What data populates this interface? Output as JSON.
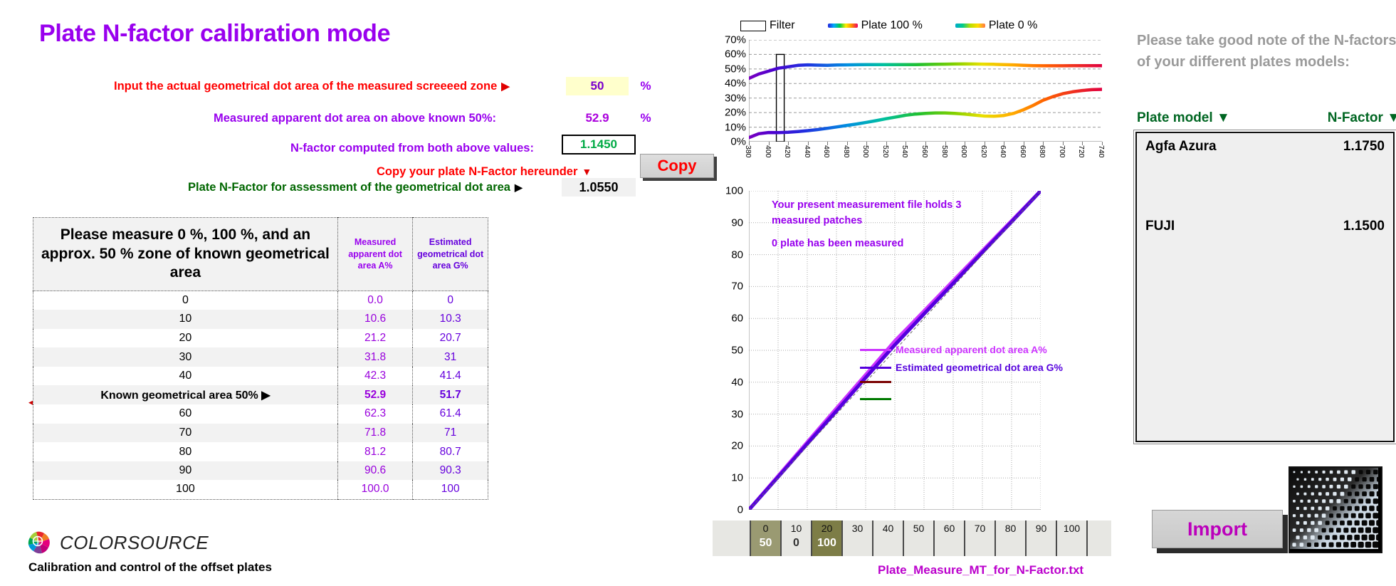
{
  "title": "Plate N-factor calibration mode",
  "form": {
    "input_label": "Input the actual geometrical dot area of the measured screeeed zone",
    "input_value": "50",
    "input_unit": "%",
    "measured_label": "Measured apparent dot area on above known 50%:",
    "measured_value": "52.9",
    "measured_unit": "%",
    "nfactor_label": "N-factor computed from both above values:",
    "nfactor_value": "1.1450",
    "copy_label": "Copy your plate N-Factor hereunder",
    "copy_button": "Copy",
    "plate_nfactor_label": "Plate N-Factor for assessment of the geometrical dot area",
    "plate_nfactor_value": "1.0550"
  },
  "table": {
    "header_main": "Please measure 0 %, 100 %, and an approx. 50 % zone of known geometrical area",
    "header_a": "Measured apparent dot area A%",
    "header_g": "Estimated geometrical dot area G%",
    "rows": [
      {
        "label": "0",
        "a": "0.0",
        "g": "0",
        "known": false
      },
      {
        "label": "10",
        "a": "10.6",
        "g": "10.3",
        "known": false
      },
      {
        "label": "20",
        "a": "21.2",
        "g": "20.7",
        "known": false
      },
      {
        "label": "30",
        "a": "31.8",
        "g": "31",
        "known": false
      },
      {
        "label": "40",
        "a": "42.3",
        "g": "41.4",
        "known": false
      },
      {
        "label": "Known geometrical area 50%",
        "a": "52.9",
        "g": "51.7",
        "known": true
      },
      {
        "label": "60",
        "a": "62.3",
        "g": "61.4",
        "known": false
      },
      {
        "label": "70",
        "a": "71.8",
        "g": "71",
        "known": false
      },
      {
        "label": "80",
        "a": "81.2",
        "g": "80.7",
        "known": false
      },
      {
        "label": "90",
        "a": "90.6",
        "g": "90.3",
        "known": false
      },
      {
        "label": "100",
        "a": "100.0",
        "g": "100",
        "known": false
      }
    ]
  },
  "brand": {
    "name": "COLORSOURCE",
    "subtitle": "Calibration and control of the offset plates",
    "logo_icon": "color-wheel-icon"
  },
  "chart_data": [
    {
      "type": "line",
      "name": "spectral-reflectance-chart",
      "title": "",
      "xlabel": "",
      "ylabel": "",
      "xlim": [
        380,
        740
      ],
      "ylim": [
        0,
        70
      ],
      "ytick_labels": [
        "0%",
        "10%",
        "20%",
        "30%",
        "40%",
        "50%",
        "60%",
        "70%"
      ],
      "ytick_values": [
        0,
        10,
        20,
        30,
        40,
        50,
        60,
        70
      ],
      "xticks": [
        380,
        400,
        420,
        440,
        460,
        480,
        500,
        520,
        540,
        560,
        580,
        600,
        620,
        640,
        660,
        680,
        700,
        720,
        740
      ],
      "grid": true,
      "legend": [
        "Filter",
        "Plate 100 %",
        "Plate 0 %"
      ],
      "legend_position": "top",
      "annotation": "filter band marker at 410-415 nm",
      "series": [
        {
          "name": "Plate 100 %",
          "x": [
            380,
            390,
            400,
            410,
            420,
            430,
            440,
            450,
            460,
            470,
            480,
            490,
            500,
            510,
            520,
            530,
            540,
            550,
            560,
            570,
            580,
            590,
            600,
            610,
            620,
            630,
            640,
            650,
            660,
            670,
            680,
            690,
            700,
            710,
            720,
            730,
            740
          ],
          "values": [
            43.5,
            46.5,
            48.5,
            50.5,
            51.5,
            52.5,
            52.8,
            52.6,
            52.5,
            52.7,
            52.8,
            52.9,
            53.0,
            53.0,
            53.0,
            53.0,
            53.0,
            53.0,
            53.1,
            53.2,
            53.3,
            53.4,
            53.5,
            53.4,
            53.3,
            53.2,
            53.0,
            52.8,
            52.5,
            52.3,
            52.2,
            52.2,
            52.2,
            52.3,
            52.3,
            52.3,
            52.3
          ]
        },
        {
          "name": "Plate 0 %",
          "x": [
            380,
            390,
            400,
            410,
            420,
            430,
            440,
            450,
            460,
            470,
            480,
            490,
            500,
            510,
            520,
            530,
            540,
            550,
            560,
            570,
            580,
            590,
            600,
            610,
            620,
            630,
            640,
            650,
            660,
            670,
            680,
            690,
            700,
            710,
            720,
            730,
            740
          ],
          "values": [
            2.8,
            5.5,
            6.3,
            6.2,
            6.5,
            7.0,
            7.6,
            8.3,
            9.2,
            10.2,
            11.2,
            12.2,
            13.3,
            14.5,
            15.8,
            17.0,
            18.2,
            19.0,
            19.5,
            19.8,
            19.8,
            19.5,
            19.0,
            18.3,
            17.6,
            17.5,
            18.0,
            19.5,
            22.0,
            25.0,
            28.5,
            31.0,
            33.0,
            34.3,
            35.2,
            35.8,
            36.0
          ]
        }
      ]
    },
    {
      "type": "line",
      "name": "dot-area-transfer-chart",
      "title": "",
      "xlabel": "",
      "ylabel": "",
      "xlim": [
        0,
        100
      ],
      "ylim": [
        0,
        100
      ],
      "ytick_labels": [
        "0",
        "10",
        "20",
        "30",
        "40",
        "50",
        "60",
        "70",
        "80",
        "90",
        "100"
      ],
      "ytick_values": [
        0,
        10,
        20,
        30,
        40,
        50,
        60,
        70,
        80,
        90,
        100
      ],
      "xticks": [
        0,
        10,
        20,
        30,
        40,
        50,
        60,
        70,
        80,
        90,
        100
      ],
      "grid": true,
      "legend": [
        "Measured apparent dot area A%",
        "Estimated geometrical dot area G%"
      ],
      "legend_position": "inside-lower-right",
      "annotations": [
        "Your present measurement file holds 3 measured patches",
        "0 plate has been measured"
      ],
      "series": [
        {
          "name": "Measured apparent dot area A%",
          "color": "#cc33ff",
          "x": [
            0,
            10,
            20,
            30,
            40,
            50,
            60,
            70,
            80,
            90,
            100
          ],
          "values": [
            0.0,
            10.6,
            21.2,
            31.8,
            42.3,
            52.9,
            62.3,
            71.8,
            81.2,
            90.6,
            100.0
          ]
        },
        {
          "name": "Estimated geometrical dot area G%",
          "color": "#5500dd",
          "x": [
            0,
            10,
            20,
            30,
            40,
            50,
            60,
            70,
            80,
            90,
            100
          ],
          "values": [
            0,
            10.3,
            20.7,
            31,
            41.4,
            51.7,
            61.4,
            71,
            80.7,
            90.3,
            100
          ]
        },
        {
          "name": "reference diagonal",
          "color": "#666666",
          "style": "dashed",
          "x": [
            0,
            100
          ],
          "values": [
            0,
            100
          ]
        }
      ]
    }
  ],
  "dot_chart_notes": {
    "line1": "Your present measurement file holds 3",
    "line2": "measured patches",
    "line3": "0 plate has been measured",
    "legend_a": "Measured apparent dot area A%",
    "legend_g": "Estimated geometrical dot area G%"
  },
  "patch_strip": {
    "top_labels": [
      "0",
      "10",
      "20",
      "30",
      "40",
      "50",
      "60",
      "70",
      "80",
      "90",
      "100",
      ""
    ],
    "bottom_labels": [
      "50",
      "0",
      "100",
      "",
      "",
      "",
      "",
      "",
      "",
      "",
      "",
      ""
    ],
    "highlight": [
      true,
      false,
      true,
      false,
      false,
      false,
      false,
      false,
      false,
      false,
      false,
      false
    ]
  },
  "file_name": "Plate_Measure_MT_for_N-Factor.txt",
  "right_panel": {
    "note": "Please take good note of the N-factors of your different plates models:",
    "col_plate": "Plate model",
    "col_nfactor": "N-Factor",
    "sort_icon": "chevron-down-icon",
    "plates": [
      {
        "model": "Agfa Azura",
        "nfactor": "1.1750"
      },
      {
        "model": "FUJI",
        "nfactor": "1.1500"
      }
    ],
    "import_button": "Import",
    "plate_image": "halftone-dot-plate-image"
  },
  "colors": {
    "title": "#9900ee",
    "red": "#ff0000",
    "purple": "#9900ee",
    "green": "#006600",
    "nfactor_value": "#00aa44",
    "magenta": "#bb00cc"
  }
}
